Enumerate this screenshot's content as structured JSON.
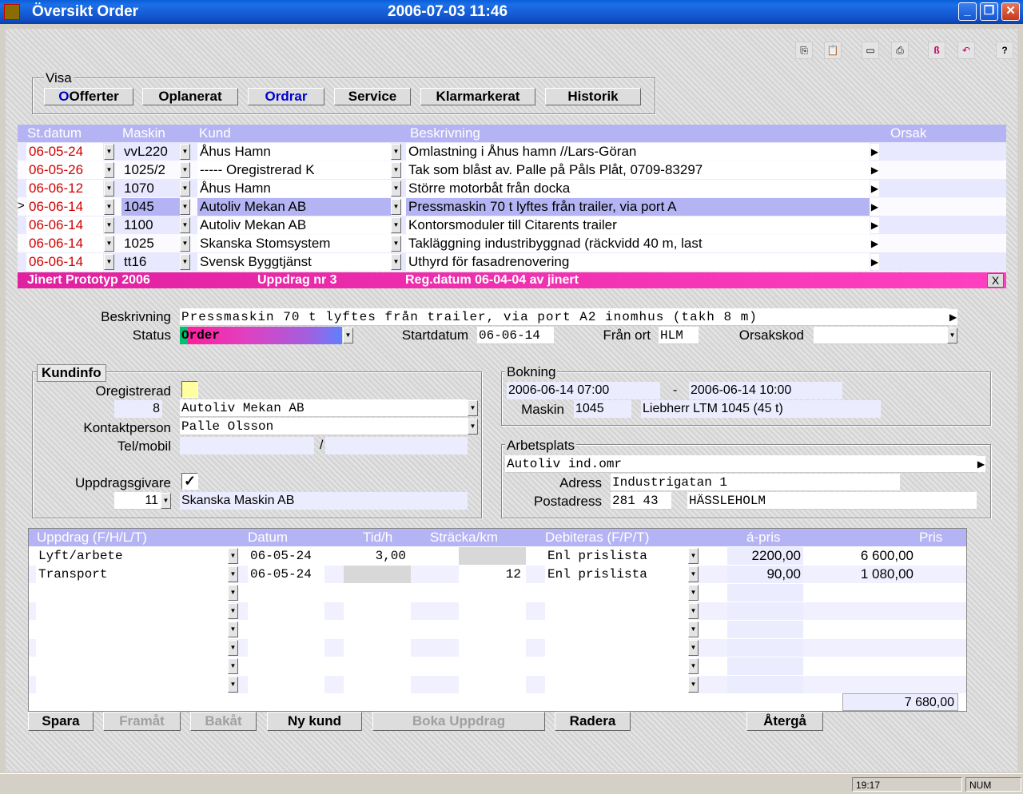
{
  "window": {
    "title": "Översikt Order",
    "datetime": "2006-07-03 11:46"
  },
  "toolbar": {
    "icons": [
      "copy-icon",
      "paste-icon",
      "screen-icon",
      "print-icon",
      "logo-icon",
      "undo-icon",
      "help-icon"
    ],
    "help_label": "?"
  },
  "visa": {
    "legend": "Visa",
    "buttons": [
      "Offerter",
      "Oplanerat",
      "Ordrar",
      "Service",
      "Klarmarkerat",
      "Historik"
    ]
  },
  "orders": {
    "headers": [
      "St.datum",
      "Maskin",
      "Kund",
      "Beskrivning",
      "Orsak"
    ],
    "rows": [
      {
        "date": "06-05-24",
        "machine": "vvL220",
        "customer": "Åhus Hamn",
        "desc": "Omlastning i Åhus hamn //Lars-Göran"
      },
      {
        "date": "06-05-26",
        "machine": "1025/2",
        "customer": "----- Oregistrerad K",
        "desc": "Tak som blåst av. Palle på Påls Plåt, 0709-83297"
      },
      {
        "date": "06-06-12",
        "machine": "1070",
        "customer": "Åhus Hamn",
        "desc": "Större motorbåt från docka"
      },
      {
        "date": "06-06-14",
        "machine": "1045",
        "customer": "Autoliv Mekan AB",
        "desc": "Pressmaskin 70 t lyftes från trailer, via port A"
      },
      {
        "date": "06-06-14",
        "machine": "1100",
        "customer": "Autoliv Mekan AB",
        "desc": "Kontorsmoduler till Citarents trailer"
      },
      {
        "date": "06-06-14",
        "machine": "1025",
        "customer": "Skanska Stomsystem",
        "desc": "Takläggning industribyggnad (räckvidd 40 m, last"
      },
      {
        "date": "06-06-14",
        "machine": "tt16",
        "customer": "Svensk Byggtjänst",
        "desc": "Uthyrd för fasadrenovering"
      }
    ],
    "selected_marker": ">"
  },
  "detail": {
    "banner": {
      "app": "Jinert Prototyp 2006",
      "uppdrag": "Uppdrag nr 3",
      "regdatum": "Reg.datum 06-04-04  av jinert",
      "close": "X"
    },
    "beskrivning_label": "Beskrivning",
    "beskrivning": "Pressmaskin 70 t lyftes från trailer, via port A2 inomhus (takh 8 m)",
    "status_label": "Status",
    "status": "Order",
    "startdatum_label": "Startdatum",
    "startdatum": "06-06-14",
    "franort_label": "Från ort",
    "franort": "HLM",
    "orsakskod_label": "Orsakskod",
    "orsakskod": ""
  },
  "kundinfo": {
    "legend": "Kundinfo",
    "oreg_label": "Oregistrerad",
    "kundnr": "8",
    "kund": "Autoliv Mekan AB",
    "kontakt_label": "Kontaktperson",
    "kontakt": "Palle Olsson",
    "tel_label": "Tel/mobil",
    "tel": "",
    "mobil": "",
    "sep": "/",
    "uppdragsgivare_label": "Uppdragsgivare",
    "ug_nr": "11",
    "ug_namn": "Skanska Maskin AB"
  },
  "bokning": {
    "legend": "Bokning",
    "from": "2006-06-14 07:00",
    "dash": "-",
    "to": "2006-06-14 10:00",
    "maskin_label": "Maskin",
    "maskin": "1045",
    "maskin_namn": "Liebherr LTM 1045 (45 t)"
  },
  "arbetsplats": {
    "legend": "Arbetsplats",
    "namn": "Autoliv ind.omr",
    "adress_label": "Adress",
    "adress": "Industrigatan 1",
    "post_label": "Postadress",
    "postnr": "281 43",
    "ort": "HÄSSLEHOLM"
  },
  "lines": {
    "headers": [
      "Uppdrag (F/H/L/T)",
      "Datum",
      "Tid/h",
      "Sträcka/km",
      "Debiteras (F/P/T)",
      "á-pris",
      "Pris"
    ],
    "rows": [
      {
        "uppdrag": "Lyft/arbete",
        "datum": "06-05-24",
        "tid": "3,00",
        "km": "",
        "deb": "Enl prislista",
        "apris": "2200,00",
        "pris": "6 600,00"
      },
      {
        "uppdrag": "Transport",
        "datum": "06-05-24",
        "tid": "",
        "km": "12",
        "deb": "Enl prislista",
        "apris": "90,00",
        "pris": "1 080,00"
      },
      {
        "uppdrag": "",
        "datum": "",
        "tid": "",
        "km": "",
        "deb": "",
        "apris": "",
        "pris": ""
      },
      {
        "uppdrag": "",
        "datum": "",
        "tid": "",
        "km": "",
        "deb": "",
        "apris": "",
        "pris": ""
      },
      {
        "uppdrag": "",
        "datum": "",
        "tid": "",
        "km": "",
        "deb": "",
        "apris": "",
        "pris": ""
      },
      {
        "uppdrag": "",
        "datum": "",
        "tid": "",
        "km": "",
        "deb": "",
        "apris": "",
        "pris": ""
      },
      {
        "uppdrag": "",
        "datum": "",
        "tid": "",
        "km": "",
        "deb": "",
        "apris": "",
        "pris": ""
      },
      {
        "uppdrag": "",
        "datum": "",
        "tid": "",
        "km": "",
        "deb": "",
        "apris": "",
        "pris": ""
      }
    ],
    "total": "7 680,00"
  },
  "actions": [
    "Spara",
    "Framåt",
    "Bakåt",
    "Ny kund",
    "Boka Uppdrag",
    "Radera",
    "Återgå"
  ],
  "statusbar": {
    "time": "19:17",
    "num": "NUM"
  },
  "colors": {
    "header": "#b4b4f4",
    "banner": "#e020a0",
    "red_date": "#d00000",
    "accent": "#0000cc"
  }
}
